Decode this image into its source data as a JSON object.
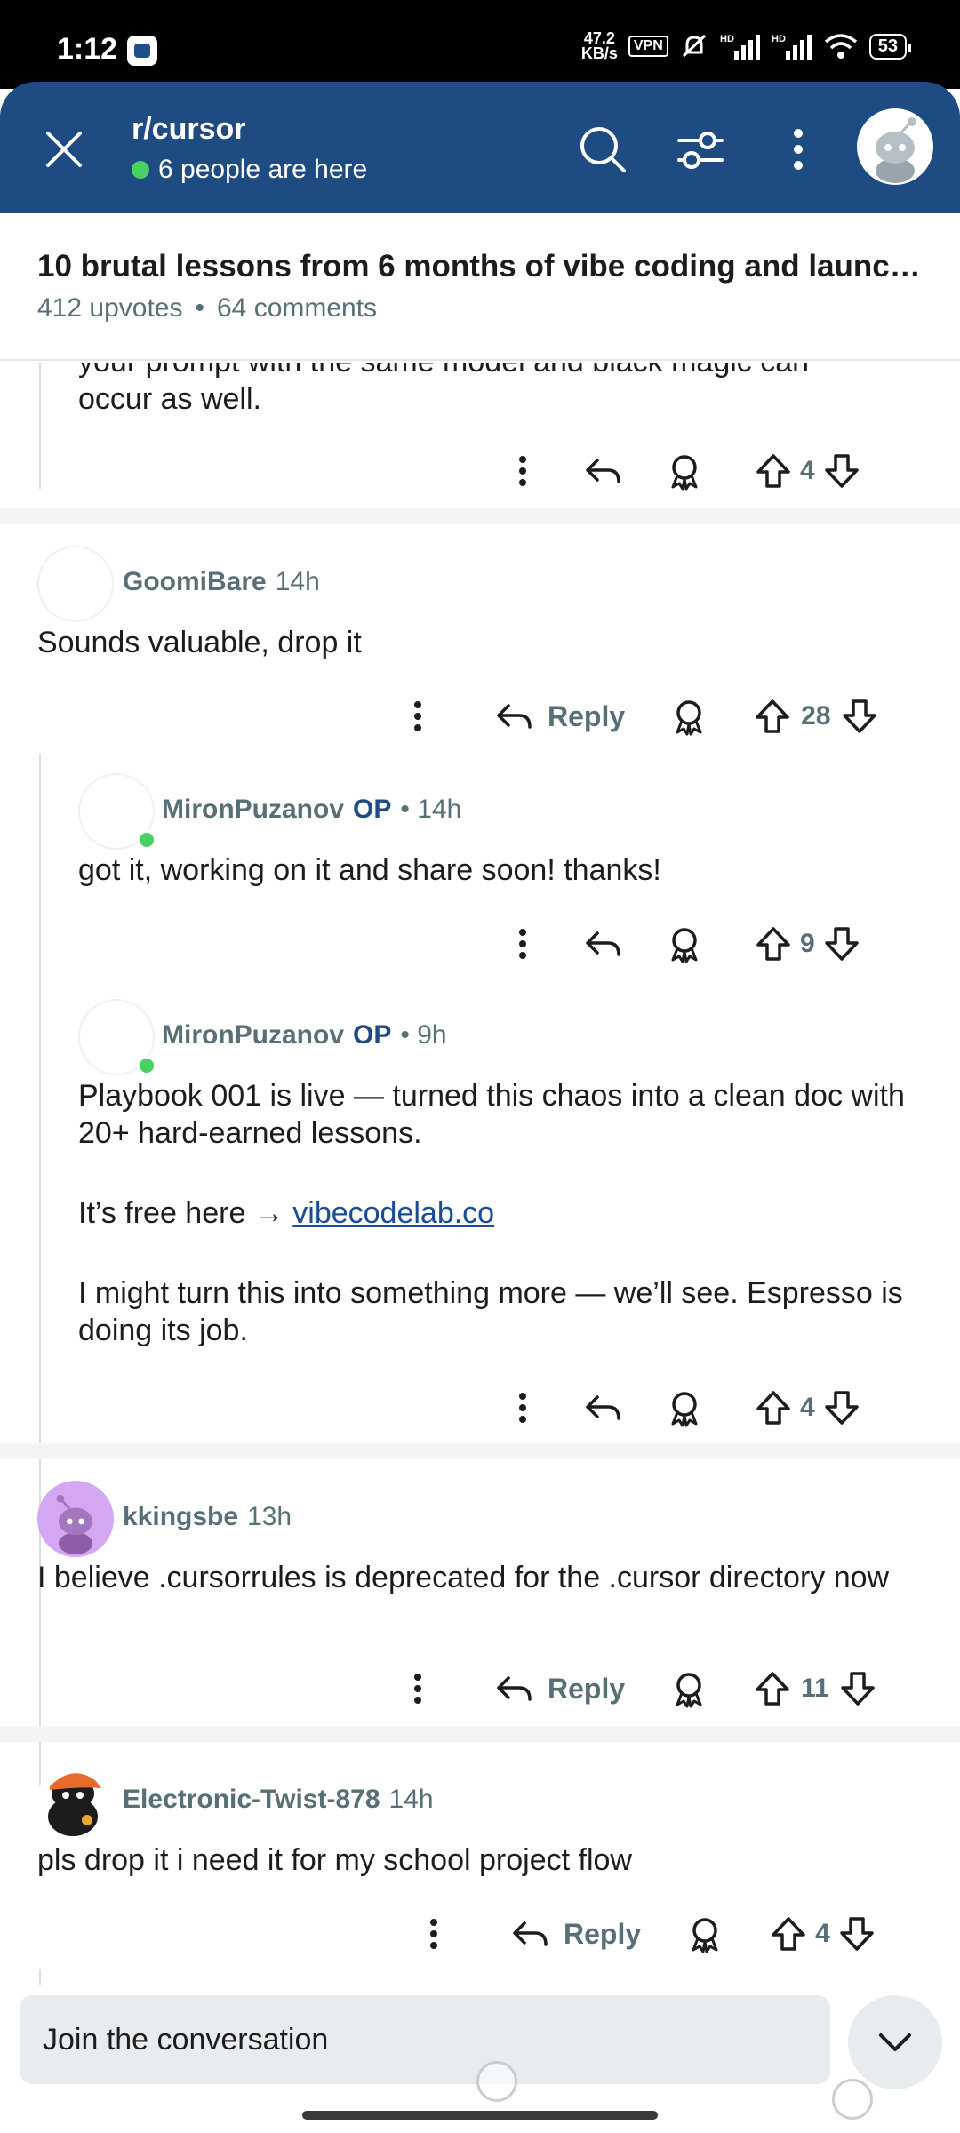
{
  "status_bar": {
    "time": "1:12",
    "speed_value": "47.2",
    "speed_unit": "KB/s",
    "vpn": "VPN",
    "battery": "53"
  },
  "header": {
    "subreddit": "r/cursor",
    "presence": "6 people are here"
  },
  "post": {
    "title": "10 brutal lessons from 6 months of vibe coding and launchi...",
    "upvotes": "412 upvotes",
    "comments": "64 comments"
  },
  "comments": [
    {
      "text_line1": "your prompt with the same model and black magic can",
      "text_line2": "occur as well.",
      "votes": "4"
    },
    {
      "user": "GoomiBare",
      "age": "14h",
      "text": "Sounds valuable, drop it",
      "reply": "Reply",
      "votes": "28"
    },
    {
      "user": "MironPuzanov",
      "op": "OP",
      "age": "• 14h",
      "text": "got it, working on it and share soon! thanks!",
      "votes": "9"
    },
    {
      "user": "MironPuzanov",
      "op": "OP",
      "age": "• 9h",
      "para1": "Playbook 001 is live — turned this chaos into a clean doc with 20+ hard-earned lessons.",
      "para2_prefix": "It’s free here → ",
      "para2_link": "vibecodelab.co",
      "para3": "I might turn this into something more — we’ll see. Espresso is doing its job.",
      "votes": "4"
    },
    {
      "user": "kkingsbe",
      "age": "13h",
      "text": "I believe .cursorrules is deprecated for the .cursor directory now",
      "reply": "Reply",
      "votes": "11"
    },
    {
      "user": "Electronic-Twist-878",
      "age": "14h",
      "text": "pls drop it i need it for my school project flow",
      "reply": "Reply",
      "votes": "4"
    }
  ],
  "bottom": {
    "placeholder": "Join the conversation"
  },
  "colors": {
    "header_bg": "#1e4b82",
    "online": "#46d160",
    "op_label": "#1e4b82",
    "link": "#1a4d98"
  },
  "icons": [
    "close-icon",
    "search-icon",
    "filter-icon",
    "more-vertical-icon",
    "reply-icon",
    "award-icon",
    "upvote-icon",
    "downvote-icon",
    "chevron-down-icon"
  ]
}
